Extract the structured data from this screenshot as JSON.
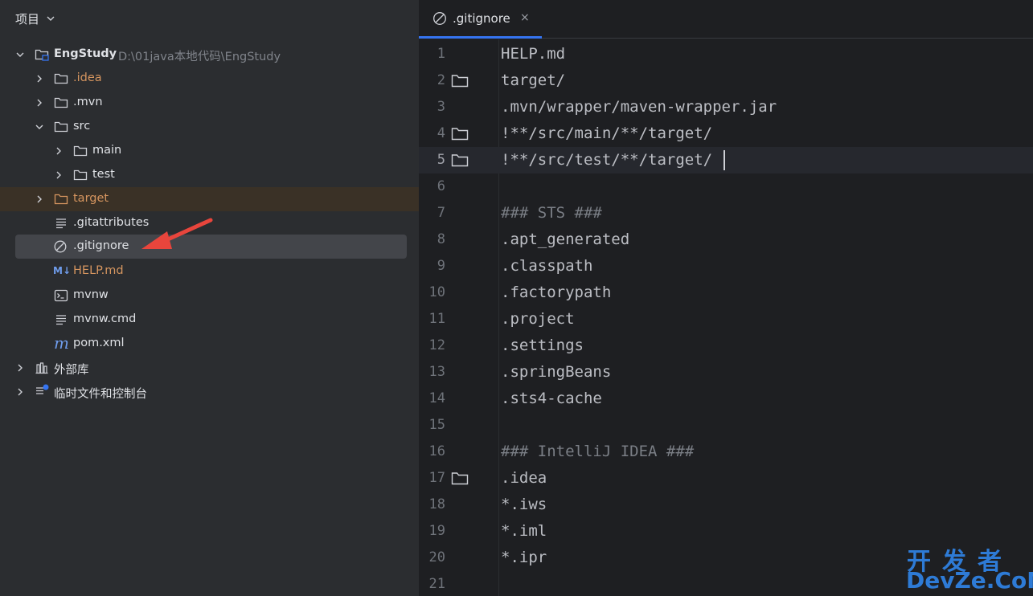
{
  "project_panel": {
    "title": "项目",
    "tree": [
      {
        "label": "EngStudy",
        "path": "D:\\01java本地代码\\EngStudy"
      },
      {
        "label": ".idea"
      },
      {
        "label": ".mvn"
      },
      {
        "label": "src"
      },
      {
        "label": "main"
      },
      {
        "label": "test"
      },
      {
        "label": "target"
      },
      {
        "label": ".gitattributes"
      },
      {
        "label": ".gitignore"
      },
      {
        "label": "HELP.md",
        "icon_text": "M↓"
      },
      {
        "label": "mvnw"
      },
      {
        "label": "mvnw.cmd"
      },
      {
        "label": "pom.xml",
        "icon_text": "m"
      },
      {
        "label": "外部库"
      },
      {
        "label": "临时文件和控制台"
      }
    ]
  },
  "editor": {
    "tab": {
      "label": ".gitignore",
      "close": "×"
    },
    "lines": [
      {
        "num": "1",
        "text": "HELP.md"
      },
      {
        "num": "2",
        "text": "target/"
      },
      {
        "num": "3",
        "text": ".mvn/wrapper/maven-wrapper.jar"
      },
      {
        "num": "4",
        "text": "!**/src/main/**/target/"
      },
      {
        "num": "5",
        "text": "!**/src/test/**/target/"
      },
      {
        "num": "6",
        "text": ""
      },
      {
        "num": "7",
        "text": "### STS ###"
      },
      {
        "num": "8",
        "text": ".apt_generated"
      },
      {
        "num": "9",
        "text": ".classpath"
      },
      {
        "num": "10",
        "text": ".factorypath"
      },
      {
        "num": "11",
        "text": ".project"
      },
      {
        "num": "12",
        "text": ".settings"
      },
      {
        "num": "13",
        "text": ".springBeans"
      },
      {
        "num": "14",
        "text": ".sts4-cache"
      },
      {
        "num": "15",
        "text": ""
      },
      {
        "num": "16",
        "text": "### IntelliJ IDEA ###"
      },
      {
        "num": "17",
        "text": ".idea"
      },
      {
        "num": "18",
        "text": "*.iws"
      },
      {
        "num": "19",
        "text": "*.iml"
      },
      {
        "num": "20",
        "text": "*.ipr"
      },
      {
        "num": "21",
        "text": ""
      }
    ]
  },
  "watermark": {
    "top": "开发者",
    "bottom": "DevZe.CoM"
  },
  "colors": {
    "accent": "#3574f0",
    "excluded": "#d5955f",
    "arrow": "#e8453c"
  }
}
